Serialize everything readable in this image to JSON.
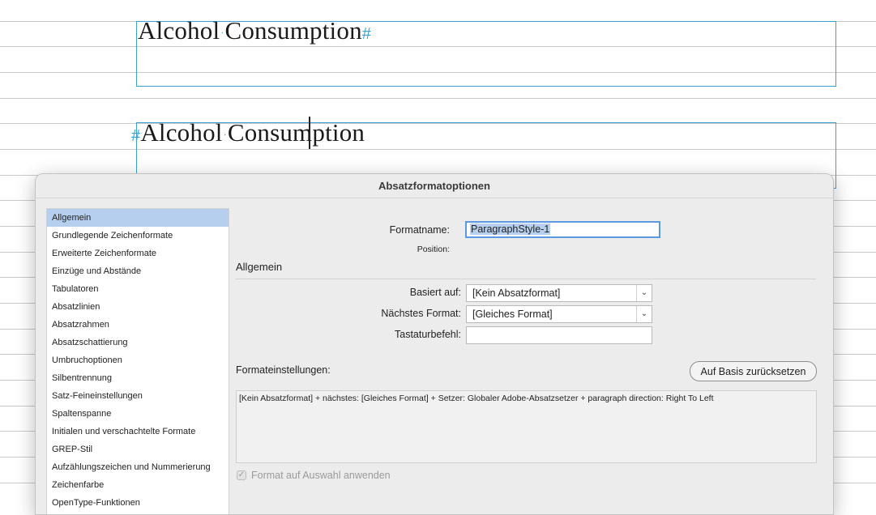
{
  "document": {
    "heading1": {
      "word1": "Alcohol",
      "word2": "Consumption",
      "mark": "#"
    },
    "heading2": {
      "mark": "#",
      "word1": "Alcohol",
      "word2": "Consumption"
    },
    "space_marker": "·"
  },
  "dialog": {
    "title": "Absatzformatoptionen",
    "sidebar": {
      "items": [
        {
          "label": "Allgemein",
          "selected": true
        },
        {
          "label": "Grundlegende Zeichenformate"
        },
        {
          "label": "Erweiterte Zeichenformate"
        },
        {
          "label": "Einzüge und Abstände"
        },
        {
          "label": "Tabulatoren"
        },
        {
          "label": "Absatzlinien"
        },
        {
          "label": "Absatzrahmen"
        },
        {
          "label": "Absatzschattierung"
        },
        {
          "label": "Umbruchoptionen"
        },
        {
          "label": "Silbentrennung"
        },
        {
          "label": "Satz-Feineinstellungen"
        },
        {
          "label": "Spaltenspanne"
        },
        {
          "label": "Initialen und verschachtelte Formate"
        },
        {
          "label": "GREP-Stil"
        },
        {
          "label": "Aufzählungszeichen und Nummerierung"
        },
        {
          "label": "Zeichenfarbe"
        },
        {
          "label": "OpenType-Funktionen"
        }
      ]
    },
    "formatname": {
      "label": "Formatname:",
      "value": "ParagraphStyle-1"
    },
    "position": {
      "label": "Position:"
    },
    "section_title": "Allgemein",
    "basiert_auf": {
      "label": "Basiert auf:",
      "value": "[Kein Absatzformat]"
    },
    "naechstes_format": {
      "label": "Nächstes Format:",
      "value": "[Gleiches Format]"
    },
    "tastaturbefehl": {
      "label": "Tastaturbefehl:",
      "value": ""
    },
    "formateinstellungen": {
      "label": "Formateinstellungen:",
      "reset_button": "Auf Basis zurücksetzen",
      "summary": "[Kein Absatzformat] + nächstes: [Gleiches Format] + Setzer:  Globaler Adobe-Absatzsetzer + paragraph direction: Right To Left"
    },
    "apply_checkbox": {
      "label": "Format auf Auswahl anwenden",
      "checked": true,
      "enabled": false
    }
  },
  "colors": {
    "frame": "#3aa0d6",
    "selection": "#b7cfee",
    "focus_ring": "#5b9ae0"
  }
}
